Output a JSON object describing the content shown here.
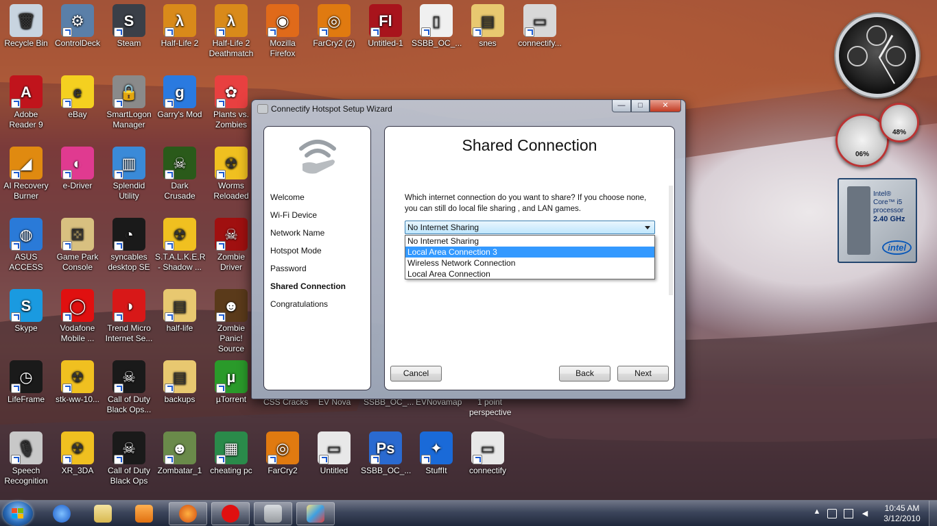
{
  "desktop": {
    "icons": [
      {
        "label": "Recycle Bin",
        "color": "#c8d4e0",
        "glyph": "🗑"
      },
      {
        "label": "ControlDeck",
        "color": "#5a7fa8",
        "glyph": "⚙"
      },
      {
        "label": "Steam",
        "color": "#3a3f48",
        "glyph": "S"
      },
      {
        "label": "Half-Life 2",
        "color": "#d98a1a",
        "glyph": "λ"
      },
      {
        "label": "Half-Life 2 Deathmatch",
        "color": "#d98a1a",
        "glyph": "λ"
      },
      {
        "label": "Mozilla Firefox",
        "color": "#e06a1a",
        "glyph": "◉"
      },
      {
        "label": "FarCry2 (2)",
        "color": "#e07a10",
        "glyph": "◎"
      },
      {
        "label": "Untitled-1",
        "color": "#a8141c",
        "glyph": "Fl"
      },
      {
        "label": "SSBB_OC_...",
        "color": "#f0f0f0",
        "glyph": "▯"
      },
      {
        "label": "snes",
        "color": "#e8c870",
        "glyph": "▤"
      },
      {
        "label": "connectify...",
        "color": "#d8d8d8",
        "glyph": "▭"
      },
      {
        "label": "Adobe Reader 9",
        "color": "#c0141c",
        "glyph": "A"
      },
      {
        "label": "eBay",
        "color": "#f4d020",
        "glyph": "e"
      },
      {
        "label": "SmartLogon Manager",
        "color": "#8a8a8a",
        "glyph": "🔒"
      },
      {
        "label": "Garry's Mod",
        "color": "#2a7ae0",
        "glyph": "g"
      },
      {
        "label": "Plants vs. Zombies",
        "color": "#e84040",
        "glyph": "✿"
      },
      {
        "label": "AI Recovery Burner",
        "color": "#e08a10",
        "glyph": "◢"
      },
      {
        "label": "e-Driver",
        "color": "#e03a90",
        "glyph": "◐"
      },
      {
        "label": "Splendid Utility",
        "color": "#3a8ad8",
        "glyph": "▥"
      },
      {
        "label": "Dark Crusade",
        "color": "#2a5a1a",
        "glyph": "☠"
      },
      {
        "label": "Worms Reloaded",
        "color": "#f0c020",
        "glyph": "☢"
      },
      {
        "label": "ASUS ACCESS",
        "color": "#2a7ad8",
        "glyph": "◍"
      },
      {
        "label": "Game Park Console",
        "color": "#d8c080",
        "glyph": "⚄"
      },
      {
        "label": "syncables desktop SE",
        "color": "#1a1a1a",
        "glyph": "◔"
      },
      {
        "label": "S.T.A.L.K.E.R. - Shadow ...",
        "color": "#f0c020",
        "glyph": "☢"
      },
      {
        "label": "Zombie Driver",
        "color": "#a01010",
        "glyph": "☠"
      },
      {
        "label": "Skype",
        "color": "#1a9ae0",
        "glyph": "S"
      },
      {
        "label": "Vodafone Mobile ...",
        "color": "#e01010",
        "glyph": "◯"
      },
      {
        "label": "Trend Micro Internet Se...",
        "color": "#d81818",
        "glyph": "◑"
      },
      {
        "label": "half-life",
        "color": "#e8c870",
        "glyph": "▤"
      },
      {
        "label": "Zombie Panic! Source",
        "color": "#5a3a1a",
        "glyph": "☻"
      },
      {
        "label": "LifeFrame",
        "color": "#1a1a1a",
        "glyph": "◷"
      },
      {
        "label": "stk-ww-10...",
        "color": "#f0c020",
        "glyph": "☢"
      },
      {
        "label": "Call of Duty Black Ops...",
        "color": "#1a1a1a",
        "glyph": "☠"
      },
      {
        "label": "backups",
        "color": "#e8c870",
        "glyph": "▤"
      },
      {
        "label": "µTorrent",
        "color": "#2a9a2a",
        "glyph": "µ"
      },
      {
        "label": "Speech Recognition",
        "color": "#c8c8c8",
        "glyph": "🎙"
      },
      {
        "label": "XR_3DA",
        "color": "#f0c020",
        "glyph": "☢"
      },
      {
        "label": "Call of Duty Black Ops",
        "color": "#1a1a1a",
        "glyph": "☠"
      },
      {
        "label": "Zombatar_1",
        "color": "#6a8a4a",
        "glyph": "☻"
      },
      {
        "label": "cheating pc",
        "color": "#2a8a4a",
        "glyph": "▦"
      },
      {
        "label": "FarCry2",
        "color": "#e07a10",
        "glyph": "◎"
      },
      {
        "label": "Untitled",
        "color": "#e8e8e8",
        "glyph": "▭"
      },
      {
        "label": "SSBB_OC_...",
        "color": "#2a6ad0",
        "glyph": "Ps"
      },
      {
        "label": "StuffIt",
        "color": "#1a6ad8",
        "glyph": "✦"
      },
      {
        "label": "connectify",
        "color": "#e8e8e8",
        "glyph": "▭"
      }
    ],
    "peek_labels": [
      "CSS Cracks",
      "EV Nova",
      "SSBB_OC_...",
      "EVNovamap",
      "1 point perspective"
    ]
  },
  "gadgets": {
    "cpu_meter": {
      "cpu_percent": "06%",
      "ram_percent": "48%"
    },
    "intel": {
      "brand": "Intel®",
      "model": "Core™ i5",
      "word": "processor",
      "speed": "2.40 GHz",
      "logo": "intel"
    }
  },
  "window": {
    "title": "Connectify Hotspot Setup Wizard",
    "controls": {
      "minimize": "—",
      "maximize": "□",
      "close": "✕"
    },
    "steps": [
      "Welcome",
      "Wi-Fi Device",
      "Network Name",
      "Hotspot Mode",
      "Password",
      "Shared Connection",
      "Congratulations"
    ],
    "active_step": "Shared Connection",
    "heading": "Shared Connection",
    "description": "Which internet connection do you want to share? If you choose none, you can still do local file sharing , and LAN games.",
    "select_value": "No Internet Sharing",
    "dropdown_options": [
      "No Internet Sharing",
      "Local Area Connection 3",
      "Wireless Network Connection",
      "Local Area Connection"
    ],
    "highlighted_option": "Local Area Connection 3",
    "buttons": {
      "cancel": "Cancel",
      "back": "Back",
      "next": "Next"
    }
  },
  "taskbar": {
    "pinned": [
      "Internet Explorer",
      "Windows Explorer",
      "Windows Media Player",
      "Mozilla Firefox",
      "Vodafone Mobile",
      "Connectify",
      "Paint"
    ],
    "open": [
      "Mozilla Firefox",
      "Vodafone Mobile",
      "Connectify",
      "Paint"
    ],
    "time": "10:45 AM",
    "date": "3/12/2010",
    "tray_arrow": "▲"
  }
}
